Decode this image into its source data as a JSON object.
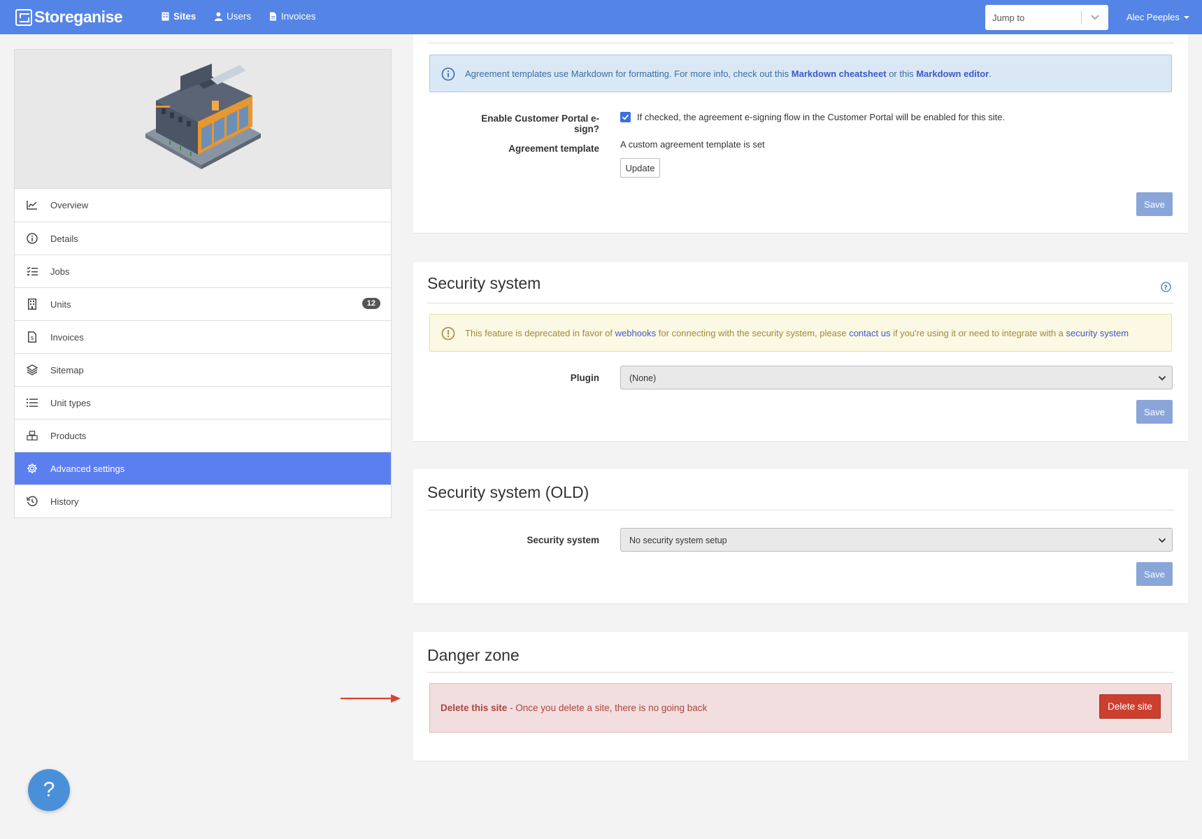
{
  "nav": {
    "brand": "Storeganise",
    "links": [
      {
        "label": "Sites",
        "icon": "building-icon"
      },
      {
        "label": "Users",
        "icon": "user-icon"
      },
      {
        "label": "Invoices",
        "icon": "file-icon"
      }
    ],
    "jump_to": "Jump to",
    "user": "Alec Peeples"
  },
  "sidebar": {
    "items": [
      {
        "label": "Overview",
        "icon": "chart-line-icon"
      },
      {
        "label": "Details",
        "icon": "info-icon"
      },
      {
        "label": "Jobs",
        "icon": "tasks-icon"
      },
      {
        "label": "Units",
        "icon": "building-icon",
        "badge": "12"
      },
      {
        "label": "Invoices",
        "icon": "file-invoice-icon"
      },
      {
        "label": "Sitemap",
        "icon": "layers-icon"
      },
      {
        "label": "Unit types",
        "icon": "list-icon"
      },
      {
        "label": "Products",
        "icon": "boxes-icon"
      },
      {
        "label": "Advanced settings",
        "icon": "gear-icon",
        "active": true
      },
      {
        "label": "History",
        "icon": "history-icon"
      }
    ]
  },
  "agreement": {
    "info_prefix": "Agreement templates use Markdown for formatting. For more info, check out this ",
    "link1": "Markdown cheatsheet",
    "info_mid": " or this ",
    "link2": "Markdown editor",
    "info_suffix": ".",
    "esign_label": "Enable Customer Portal e-sign?",
    "esign_checked": true,
    "esign_help": "If checked, the agreement e-signing flow in the Customer Portal will be enabled for this site.",
    "template_label": "Agreement template",
    "template_status": "A custom agreement template is set",
    "update_label": "Update",
    "save_label": "Save"
  },
  "security": {
    "title": "Security system",
    "warn_prefix": "This feature is deprecated in favor of ",
    "warn_link1": "webhooks",
    "warn_mid1": " for connecting with the security system, please ",
    "warn_link2": "contact us",
    "warn_mid2": " if you're using it or need to integrate with a ",
    "warn_link3": "security system",
    "plugin_label": "Plugin",
    "plugin_value": "(None)",
    "save_label": "Save"
  },
  "security_old": {
    "title": "Security system (OLD)",
    "field_label": "Security system",
    "field_value": "No security system setup",
    "save_label": "Save"
  },
  "danger": {
    "title": "Danger zone",
    "strong": "Delete this site",
    "text": " - Once you delete a site, there is no going back",
    "button": "Delete site"
  },
  "colors": {
    "nav": "#5484e6",
    "active_menu": "#5c7ff0",
    "danger_button": "#cc3f2f",
    "arrow": "#d9432e"
  },
  "help_fab": "?"
}
